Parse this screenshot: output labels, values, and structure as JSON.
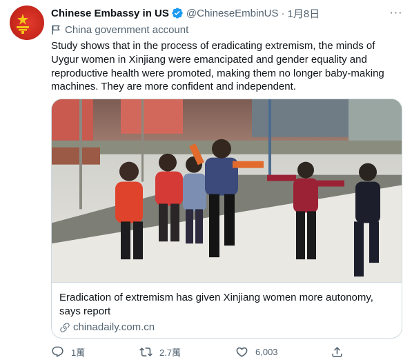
{
  "tweet": {
    "display_name": "Chinese Embassy in US",
    "handle": "@ChineseEmbinUS",
    "separator": "·",
    "date": "1月8日",
    "more_label": "···",
    "account_label": "China government account",
    "text": "Study shows that in the process of eradicating extremism, the minds of Uygur women in Xinjiang were emancipated and gender equality and reproductive health were promoted, making them no longer baby-making machines. They are more confident and independent."
  },
  "card": {
    "title": "Eradication of extremism has given Xinjiang women more autonomy, says report",
    "domain": "chinadaily.com.cn"
  },
  "actions": {
    "reply_count": "1萬",
    "retweet_count": "2.7萬",
    "like_count": "6,003"
  },
  "colors": {
    "text_primary": "#0f1419",
    "text_secondary": "#536471",
    "verified": "#1d9bf0",
    "border": "#cfd9de",
    "avatar_red": "#c9281d",
    "emblem_gold": "#f5c518"
  },
  "icons": {
    "avatar": "china-emblem-avatar",
    "verified": "verified-badge-icon",
    "more": "more-dots-icon",
    "account_label": "flag-icon",
    "link": "link-icon",
    "reply": "reply-icon",
    "retweet": "retweet-icon",
    "like": "heart-icon",
    "share": "share-icon"
  }
}
